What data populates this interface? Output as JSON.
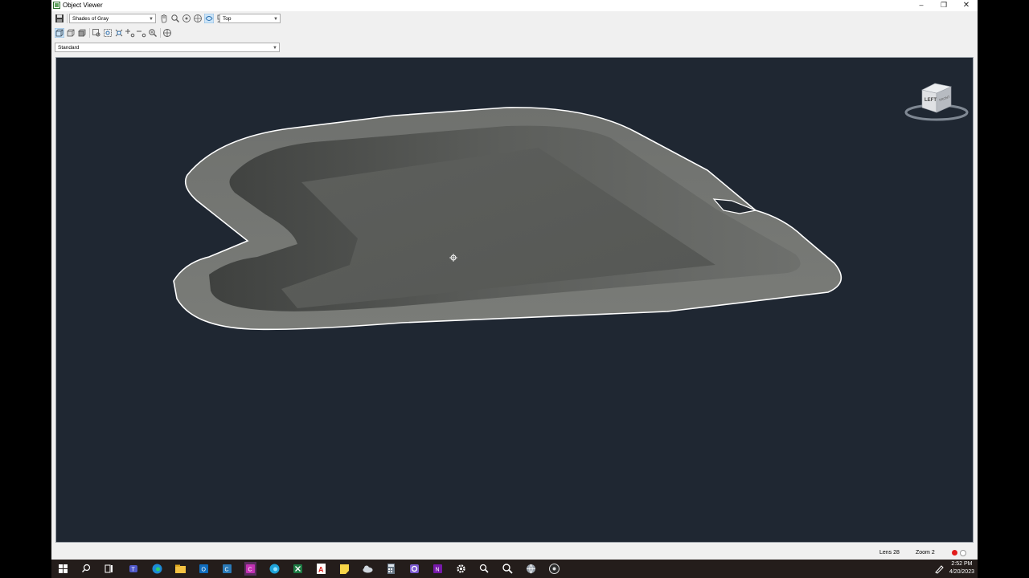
{
  "window": {
    "title": "Object Viewer"
  },
  "toolbar": {
    "visual_style": "Shades of Gray",
    "view": "Top",
    "preset": "Standard"
  },
  "viewcube": {
    "face_label": "LEFT",
    "side_label": "FRONT"
  },
  "status": {
    "lens": "Lens 28",
    "zoom": "Zoom 2"
  },
  "tray": {
    "time": "2:52 PM",
    "date": "4/20/2023"
  },
  "colors": {
    "viewport_bg": "#1f2732",
    "taskbar_bg": "#241d1b"
  }
}
